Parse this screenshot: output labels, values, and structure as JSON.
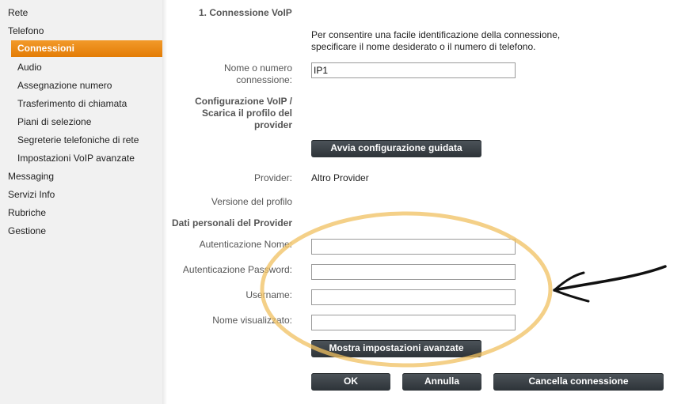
{
  "sidebar": {
    "items": [
      {
        "label": "Rete"
      },
      {
        "label": "Telefono"
      },
      {
        "label": "Connessioni"
      },
      {
        "label": "Audio"
      },
      {
        "label": "Assegnazione numero"
      },
      {
        "label": "Trasferimento di chiamata"
      },
      {
        "label": "Piani di selezione"
      },
      {
        "label": "Segreterie telefoniche di rete"
      },
      {
        "label": "Impostazioni VoIP avanzate"
      },
      {
        "label": "Messaging"
      },
      {
        "label": "Servizi Info"
      },
      {
        "label": "Rubriche"
      },
      {
        "label": "Gestione"
      }
    ]
  },
  "main": {
    "section_title": "1. Connessione VoIP",
    "intro_text_1": "Per consentire una facile identificazione della connessione,",
    "intro_text_2": "specificare il nome desiderato o il numero di telefono.",
    "connection_name_label_1": "Nome o numero",
    "connection_name_label_2": "connessione:",
    "connection_name_value": "IP1",
    "config_heading_1": "Configurazione VoIP /",
    "config_heading_2": "Scarica il profilo del",
    "config_heading_3": "provider",
    "wizard_button": "Avvia configurazione guidata",
    "provider_label": "Provider:",
    "provider_value": "Altro Provider",
    "profile_version_label": "Versione del profilo",
    "personal_data_heading": "Dati personali del Provider",
    "auth_name_label": "Autenticazione Nome:",
    "auth_name_value": "",
    "auth_password_label": "Autenticazione Password:",
    "auth_password_value": "",
    "username_label": "Username:",
    "username_value": "",
    "display_name_label": "Nome visualizzato:",
    "display_name_value": "",
    "advanced_button": "Mostra impostazioni avanzate",
    "ok_button": "OK",
    "cancel_button": "Annulla",
    "delete_button": "Cancella connessione"
  },
  "colors": {
    "accent": "#e8820c",
    "annotation_ellipse": "#f0c060",
    "button_dark": "#3a4045"
  },
  "annotation": {
    "shapes": [
      "highlight-ellipse",
      "arrow"
    ]
  }
}
